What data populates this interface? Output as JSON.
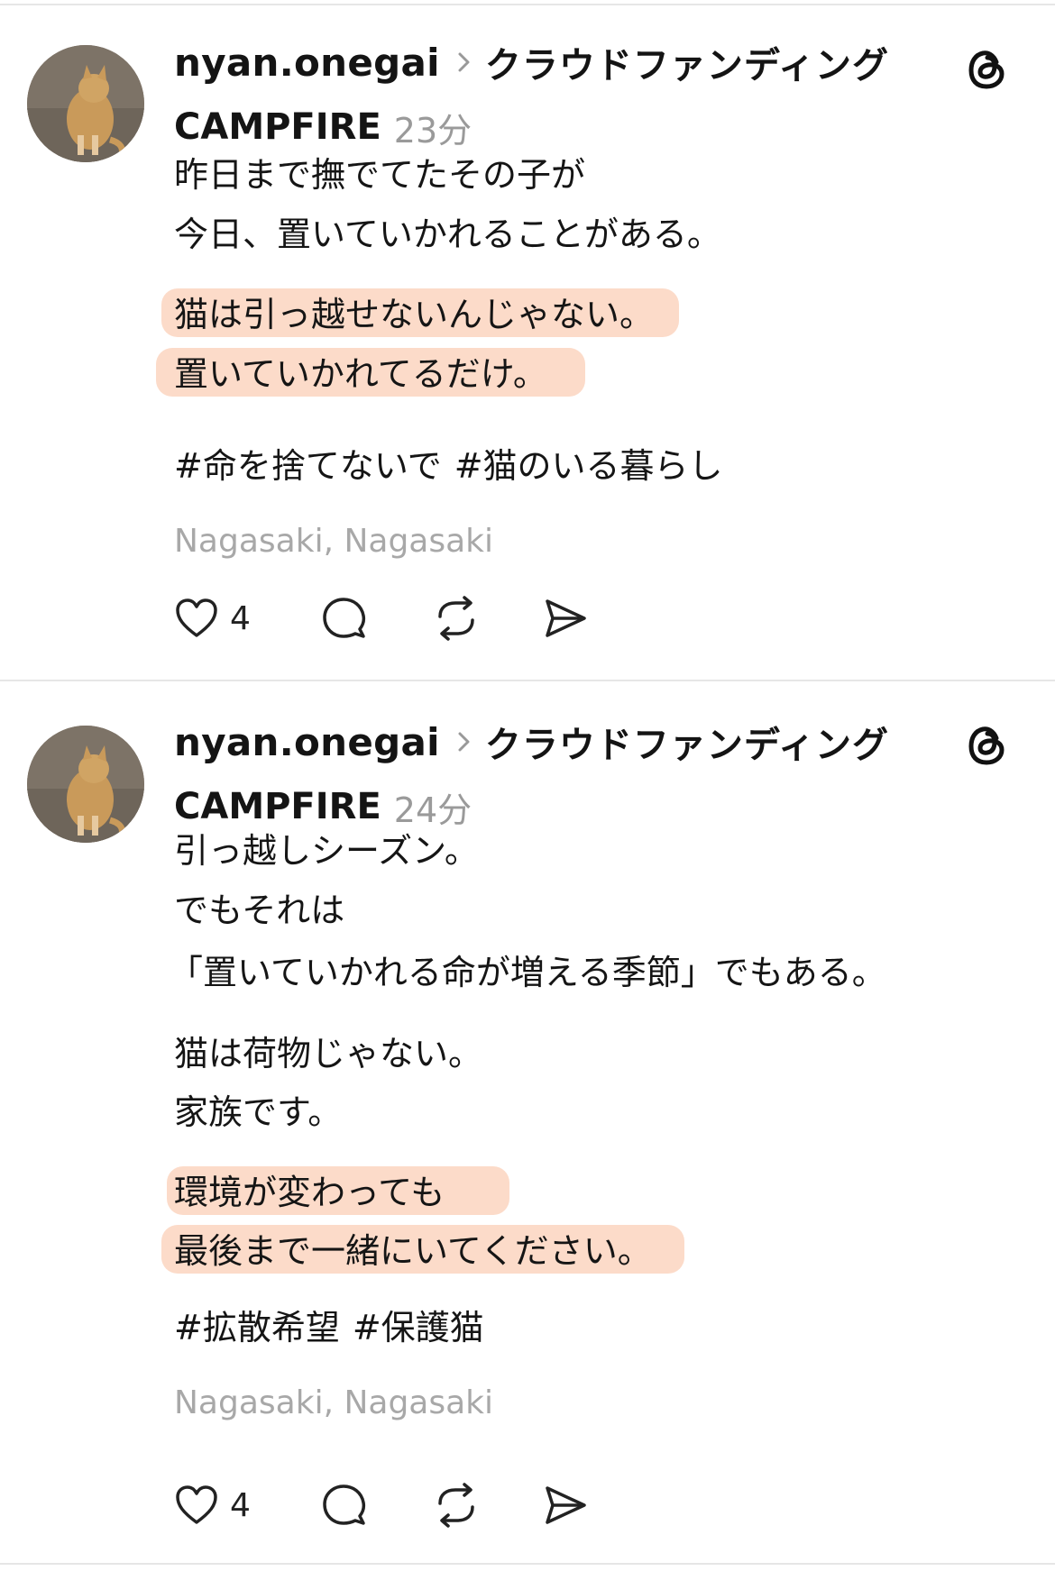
{
  "posts": [
    {
      "username": "nyan.onegai",
      "community_line1": "クラウドファンディング",
      "community_line2": "CAMPFIRE",
      "time": "23分",
      "lines": [
        "昨日まで撫でてたその子が",
        "今日、置いていかれることがある。",
        "猫は引っ越せないんじゃない。",
        "置いていかれてるだけ。"
      ],
      "hashtags": [
        "#命を捨てないで",
        "#猫のいる暮らし"
      ],
      "location": "Nagasaki, Nagasaki",
      "like_count": "4",
      "icons": [
        "heart-icon",
        "comment-icon",
        "repost-icon",
        "share-icon",
        "threads-logo-icon",
        "chevron-right-icon"
      ]
    },
    {
      "username": "nyan.onegai",
      "community_line1": "クラウドファンディング",
      "community_line2": "CAMPFIRE",
      "time": "24分",
      "lines": [
        "引っ越しシーズン。",
        "でもそれは",
        "「置いていかれる命が増える季節」でもある。",
        "猫は荷物じゃない。",
        "家族です。",
        "環境が変わっても",
        "最後まで一緒にいてください。"
      ],
      "hashtags": [
        "#拡散希望",
        "#保護猫"
      ],
      "location": "Nagasaki, Nagasaki",
      "like_count": "4",
      "icons": [
        "heart-icon",
        "comment-icon",
        "repost-icon",
        "share-icon",
        "threads-logo-icon",
        "chevron-right-icon"
      ]
    }
  ],
  "colors": {
    "highlight": "#fbd5bf",
    "muted_text": "#9a9a9a",
    "divider": "#e6e6e6"
  }
}
